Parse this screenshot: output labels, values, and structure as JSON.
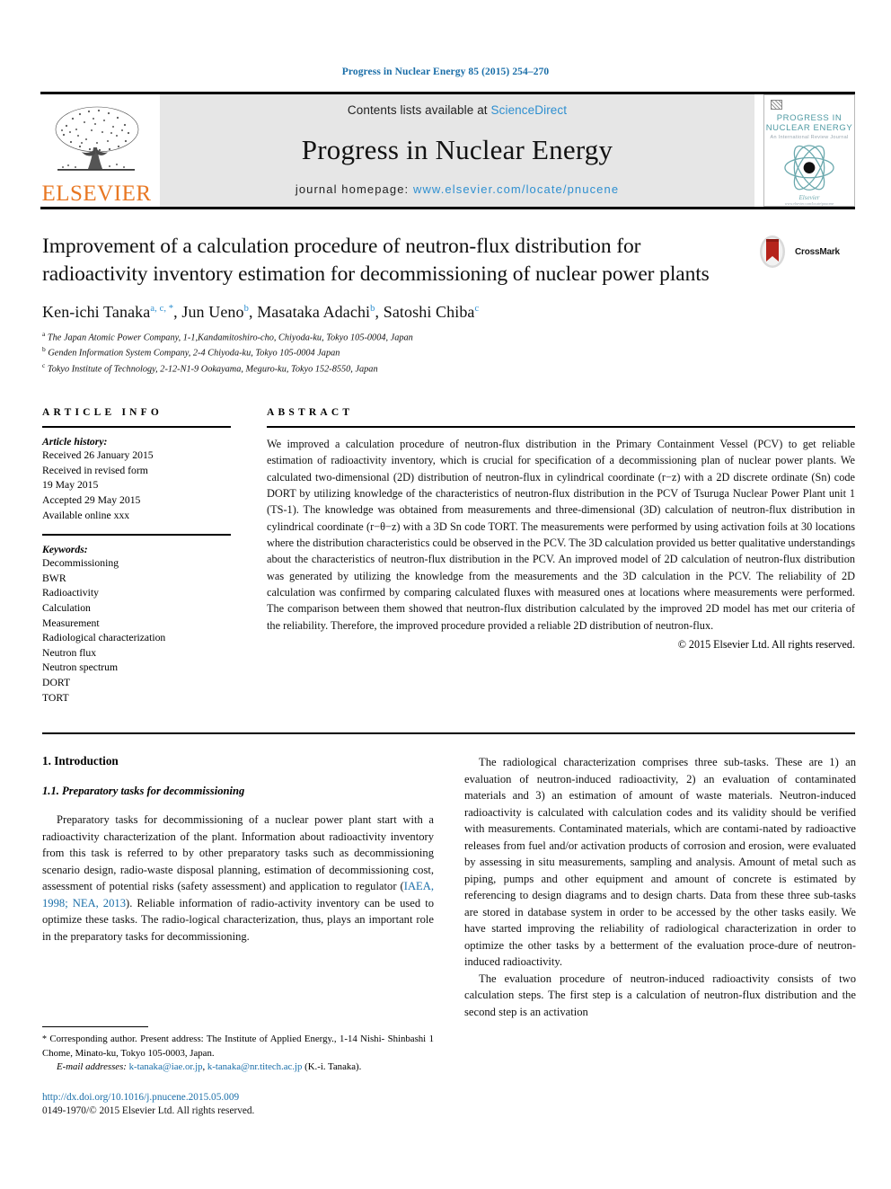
{
  "running_head": "Progress in Nuclear Energy 85 (2015) 254–270",
  "masthead": {
    "publisher_word": "ELSEVIER",
    "contents_prefix": "Contents lists available at ",
    "contents_link": "ScienceDirect",
    "journal_name": "Progress in Nuclear Energy",
    "homepage_prefix": "journal homepage: ",
    "homepage_url": "www.elsevier.com/locate/pnucene",
    "cover": {
      "line1": "PROGRESS IN",
      "line2": "NUCLEAR ENERGY",
      "line3": "An International Review Journal",
      "foot": "Elsevier",
      "foot2": "www.elsevier.com/locate/pnucene"
    }
  },
  "title": "Improvement of a calculation procedure of neutron-flux distribution for radioactivity inventory estimation for decommissioning of nuclear power plants",
  "crossmark_label": "CrossMark",
  "authors": [
    {
      "name": "Ken-ichi Tanaka",
      "marks": "a, c, *"
    },
    {
      "name": "Jun Ueno",
      "marks": "b"
    },
    {
      "name": "Masataka Adachi",
      "marks": "b"
    },
    {
      "name": "Satoshi Chiba",
      "marks": "c"
    }
  ],
  "affiliations": [
    {
      "mark": "a",
      "text": "The Japan Atomic Power Company, 1-1,Kandamitoshiro-cho, Chiyoda-ku, Tokyo 105-0004, Japan"
    },
    {
      "mark": "b",
      "text": "Genden Information System Company, 2-4 Chiyoda-ku, Tokyo 105-0004 Japan"
    },
    {
      "mark": "c",
      "text": "Tokyo Institute of Technology, 2-12-N1-9 Ookayama, Meguro-ku, Tokyo 152-8550, Japan"
    }
  ],
  "article_info": {
    "heading": "ARTICLE INFO",
    "history_label": "Article history:",
    "history": [
      "Received 26 January 2015",
      "Received in revised form",
      "19 May 2015",
      "Accepted 29 May 2015",
      "Available online xxx"
    ],
    "keywords_label": "Keywords:",
    "keywords": [
      "Decommissioning",
      "BWR",
      "Radioactivity",
      "Calculation",
      "Measurement",
      "Radiological characterization",
      "Neutron flux",
      "Neutron spectrum",
      "DORT",
      "TORT"
    ]
  },
  "abstract": {
    "heading": "ABSTRACT",
    "text": "We improved a calculation procedure of neutron-flux distribution in the Primary Containment Vessel (PCV) to get reliable estimation of radioactivity inventory, which is crucial for specification of a decommissioning plan of nuclear power plants. We calculated two-dimensional (2D) distribution of neutron-flux in cylindrical coordinate (r−z) with a 2D discrete ordinate (Sn) code DORT by utilizing knowledge of the characteristics of neutron-flux distribution in the PCV of Tsuruga Nuclear Power Plant unit 1 (TS-1). The knowledge was obtained from measurements and three-dimensional (3D) calculation of neutron-flux distribution in cylindrical coordinate (r−θ−z) with a 3D Sn code TORT. The measurements were performed by using activation foils at 30 locations where the distribution characteristics could be observed in the PCV. The 3D calculation provided us better qualitative understandings about the characteristics of neutron-flux distribution in the PCV. An improved model of 2D calculation of neutron-flux distribution was generated by utilizing the knowledge from the measurements and the 3D calculation in the PCV. The reliability of 2D calculation was confirmed by comparing calculated fluxes with measured ones at locations where measurements were performed. The comparison between them showed that neutron-flux distribution calculated by the improved 2D model has met our criteria of the reliability. Therefore, the improved procedure provided a reliable 2D distribution of neutron-flux.",
    "copyright": "© 2015 Elsevier Ltd. All rights reserved."
  },
  "body": {
    "section_number_title": "1. Introduction",
    "subsection_number_title": "1.1. Preparatory tasks for decommissioning",
    "left_para_1_a": "Preparatory tasks for decommissioning of a nuclear power plant start with a radioactivity characterization of the plant. Information about radioactivity inventory from this task is referred to by other preparatory tasks such as decommissioning scenario design, radio-waste disposal planning, estimation of decommissioning cost, assessment of potential risks (safety assessment) and application to regulator (",
    "left_para_1_cite": "IAEA, 1998; NEA, 2013",
    "left_para_1_b": "). Reliable information of radio-activity inventory can be used to optimize these tasks. The radio-logical characterization, thus, plays an important role in the preparatory tasks for decommissioning.",
    "right_para_1": "The radiological characterization comprises three sub-tasks. These are 1) an evaluation of neutron-induced radioactivity, 2) an evaluation of contaminated materials and 3) an estimation of amount of waste materials. Neutron-induced radioactivity is calculated with calculation codes and its validity should be verified with measurements. Contaminated materials, which are contami-nated by radioactive releases from fuel and/or activation products of corrosion and erosion, were evaluated by assessing in situ measurements, sampling and analysis. Amount of metal such as piping, pumps and other equipment and amount of concrete is estimated by referencing to design diagrams and to design charts. Data from these three sub-tasks are stored in database system in order to be accessed by the other tasks easily. We have started improving the reliability of radiological characterization in order to optimize the other tasks by a betterment of the evaluation proce-dure of neutron-induced radioactivity.",
    "right_para_2": "The evaluation procedure of neutron-induced radioactivity consists of two calculation steps. The first step is a calculation of neutron-flux distribution and the second step is an activation"
  },
  "footnote": {
    "star": "*",
    "corresponding_text": " Corresponding author. Present address: The Institute of Applied Energy., 1-14 Nishi- Shinbashi 1 Chome, Minato-ku, Tokyo 105-0003, Japan.",
    "email_label": "E-mail addresses:",
    "email_1": "k-tanaka@iae.or.jp",
    "email_sep": ", ",
    "email_2": "k-tanaka@nr.titech.ac.jp",
    "email_suffix": " (K.-i. Tanaka).",
    "doi": "http://dx.doi.org/10.1016/j.pnucene.2015.05.009",
    "issn": "0149-1970/© 2015 Elsevier Ltd. All rights reserved."
  },
  "colors": {
    "link_blue": "#1a6ea8",
    "sd_blue": "#2e8fd0",
    "elsevier_orange": "#E87722",
    "cover_teal": "#4f9aa3",
    "crossmark_red": "#b5241c"
  }
}
